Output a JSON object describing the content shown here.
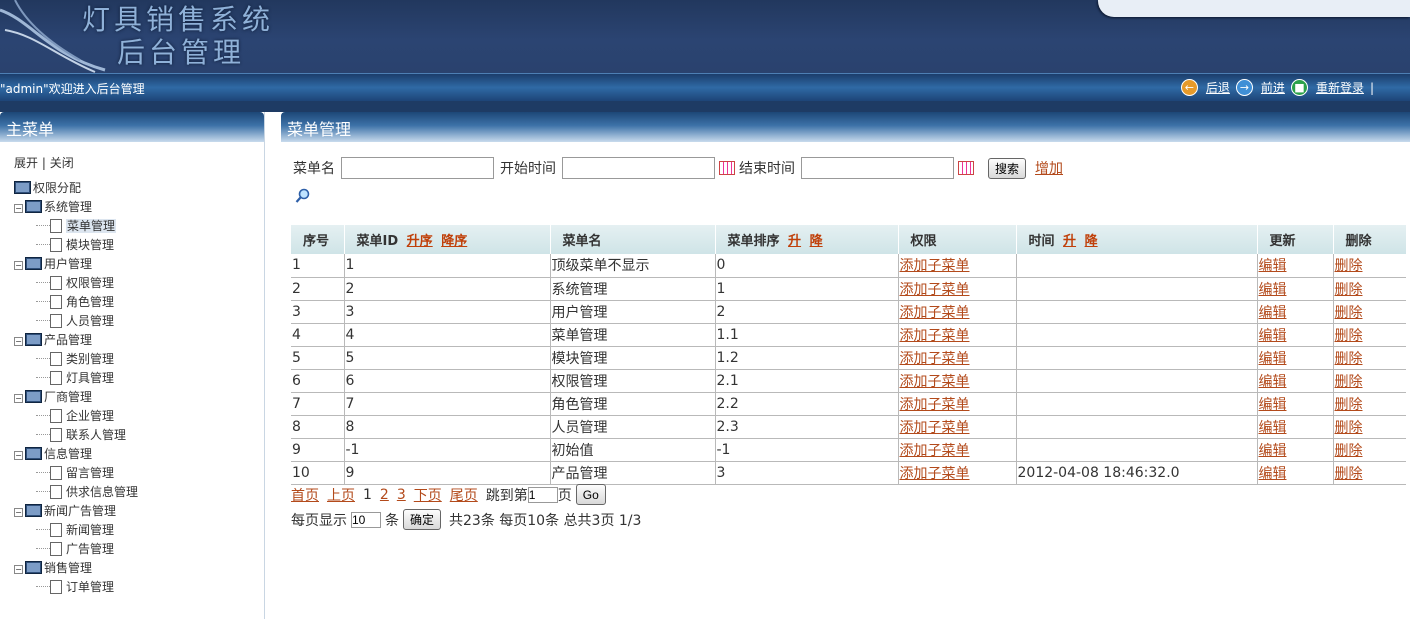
{
  "banner": {
    "title_line1": "灯具销售系统",
    "title_line2": "后台管理"
  },
  "navbar": {
    "welcome": "\"admin\"欢迎进入后台管理",
    "back": "后退",
    "forward": "前进",
    "relogin": "重新登录",
    "sep": "|"
  },
  "sidebar": {
    "title": "主菜单",
    "expand": "展开",
    "sep": "|",
    "collapse": "关闭",
    "root": "权限分配",
    "groups": [
      {
        "label": "系统管理",
        "items": [
          "菜单管理",
          "模块管理"
        ]
      },
      {
        "label": "用户管理",
        "items": [
          "权限管理",
          "角色管理",
          "人员管理"
        ]
      },
      {
        "label": "产品管理",
        "items": [
          "类别管理",
          "灯具管理"
        ]
      },
      {
        "label": "厂商管理",
        "items": [
          "企业管理",
          "联系人管理"
        ]
      },
      {
        "label": "信息管理",
        "items": [
          "留言管理",
          "供求信息管理"
        ]
      },
      {
        "label": "新闻广告管理",
        "items": [
          "新闻管理",
          "广告管理"
        ]
      },
      {
        "label": "销售管理",
        "items": [
          "订单管理"
        ]
      }
    ]
  },
  "main": {
    "title": "菜单管理",
    "search": {
      "name_label": "菜单名",
      "start_label": "开始时间",
      "end_label": "结束时间",
      "search_btn": "搜索",
      "add_link": "增加"
    },
    "table": {
      "headers": {
        "seq": "序号",
        "menu_id": "菜单ID",
        "asc": "升序",
        "desc": "降序",
        "menu_name": "菜单名",
        "menu_order": "菜单排序",
        "up": "升",
        "down": "降",
        "perm": "权限",
        "time": "时间",
        "update": "更新",
        "delete": "删除"
      },
      "rows": [
        {
          "seq": "1",
          "id": "1",
          "name": "顶级菜单不显示",
          "order": "0",
          "time": ""
        },
        {
          "seq": "2",
          "id": "2",
          "name": "系统管理",
          "order": "1",
          "time": ""
        },
        {
          "seq": "3",
          "id": "3",
          "name": "用户管理",
          "order": "2",
          "time": ""
        },
        {
          "seq": "4",
          "id": "4",
          "name": "菜单管理",
          "order": "1.1",
          "time": ""
        },
        {
          "seq": "5",
          "id": "5",
          "name": "模块管理",
          "order": "1.2",
          "time": ""
        },
        {
          "seq": "6",
          "id": "6",
          "name": "权限管理",
          "order": "2.1",
          "time": ""
        },
        {
          "seq": "7",
          "id": "7",
          "name": "角色管理",
          "order": "2.2",
          "time": ""
        },
        {
          "seq": "8",
          "id": "8",
          "name": "人员管理",
          "order": "2.3",
          "time": ""
        },
        {
          "seq": "9",
          "id": "-1",
          "name": "初始值",
          "order": "-1",
          "time": ""
        },
        {
          "seq": "10",
          "id": "9",
          "name": "产品管理",
          "order": "3",
          "time": "2012-04-08 18:46:32.0"
        }
      ],
      "add_child": "添加子菜单",
      "edit": "编辑",
      "del": "删除"
    },
    "pager": {
      "first": "首页",
      "prev": "上页",
      "pages": [
        "1",
        "2",
        "3"
      ],
      "next": "下页",
      "last": "尾页",
      "jump_label": "跳到第",
      "jump_value": "1",
      "page_unit": "页",
      "go": "Go",
      "per_page_label": "每页显示",
      "per_page_value": "10",
      "item_unit": "条",
      "confirm": "确定",
      "summary": "共23条 每页10条 总共3页 1/3"
    }
  }
}
